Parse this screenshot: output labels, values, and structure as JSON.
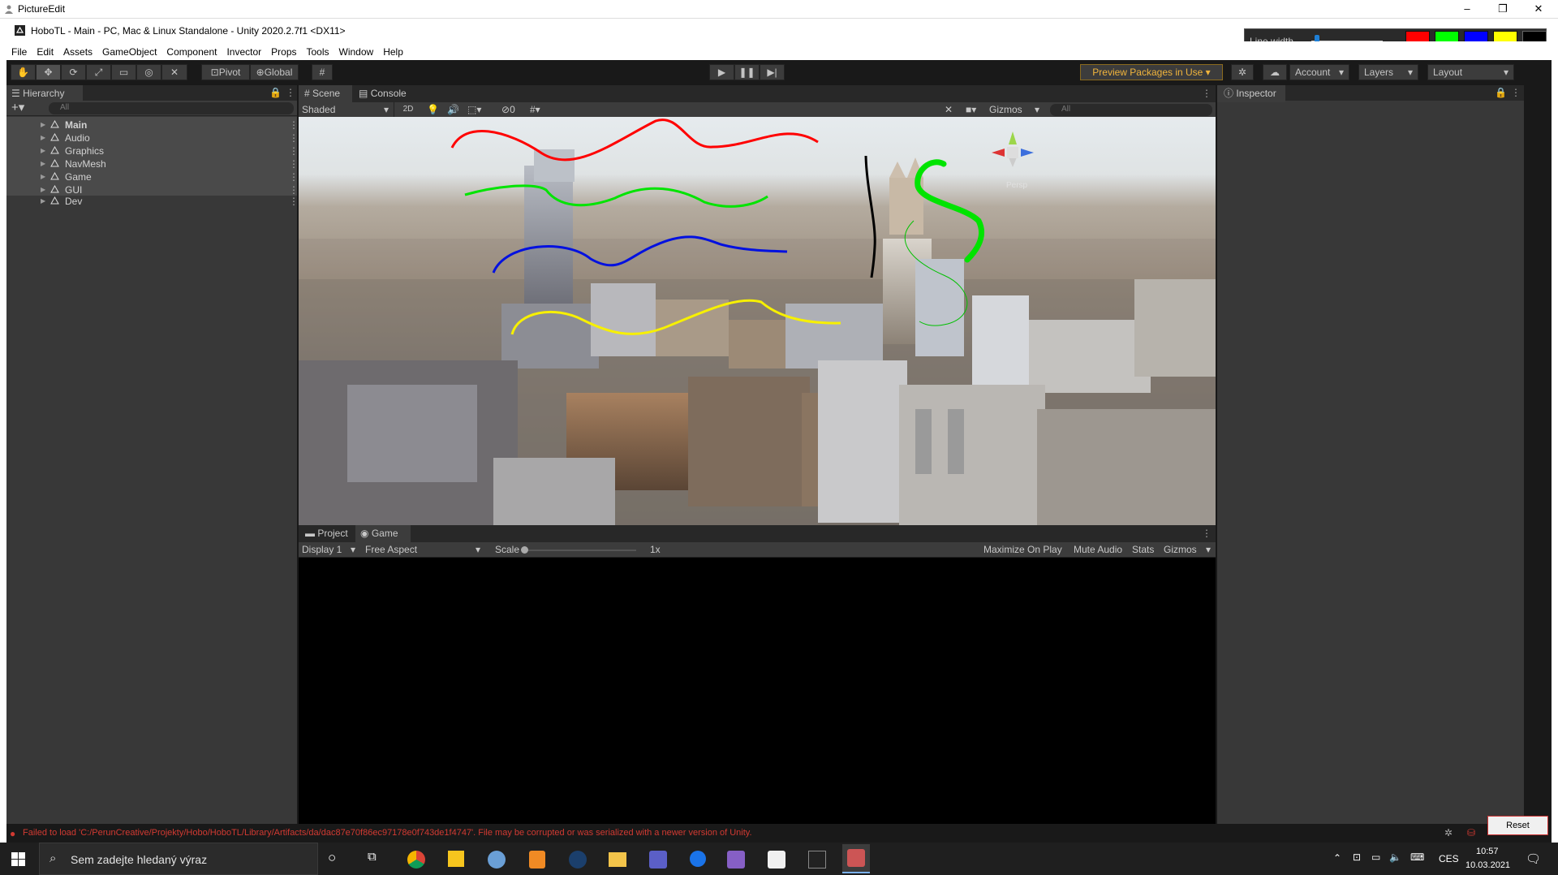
{
  "outer_window": {
    "title": "PictureEdit",
    "controls": [
      "–",
      "❐",
      "✕"
    ]
  },
  "unity": {
    "title": "HoboTL - Main - PC, Mac & Linux Standalone - Unity 2020.2.7f1 <DX11>",
    "menu": [
      "File",
      "Edit",
      "Assets",
      "GameObject",
      "Component",
      "Invector",
      "Props",
      "Tools",
      "Window",
      "Help"
    ],
    "toolbar": {
      "pivot": "Pivot",
      "global": "Global",
      "preview_packages": "Preview Packages in Use",
      "account": "Account",
      "layers": "Layers",
      "layout": "Layout"
    },
    "hierarchy": {
      "tab": "Hierarchy",
      "search_placeholder": "All",
      "items": [
        "Main",
        "Audio",
        "Graphics",
        "NavMesh",
        "Game",
        "GUI",
        "Dev"
      ]
    },
    "scene": {
      "tabs": [
        "Scene",
        "Console"
      ],
      "shading": "Shaded",
      "mode_2d": "2D",
      "fx_count": "0",
      "gizmos": "Gizmos",
      "search_placeholder": "All",
      "persp": "Persp"
    },
    "game": {
      "tabs": [
        "Project",
        "Game"
      ],
      "display": "Display 1",
      "aspect": "Free Aspect",
      "scale_label": "Scale",
      "scale_value": "1x",
      "options": [
        "Maximize On Play",
        "Mute Audio",
        "Stats",
        "Gizmos"
      ]
    },
    "inspector": {
      "tab": "Inspector"
    },
    "status_error": "Failed to load 'C:/PerunCreative/Projekty/Hobo/HoboTL/Library/Artifacts/da/dac87e70f86ec97178e0f743de1f4747'. File may be corrupted or was serialized with a newer version of Unity."
  },
  "picture_edit": {
    "line_width_label": "Line width",
    "line_width_fraction": 0.05,
    "colors": [
      "#ff0000",
      "#00ff00",
      "#0000ff",
      "#ffff00",
      "#000000"
    ],
    "reset_label": "Reset"
  },
  "taskbar": {
    "search_placeholder": "Sem zadejte hledaný výraz",
    "language": "CES",
    "time": "10:57",
    "date": "10.03.2021"
  }
}
